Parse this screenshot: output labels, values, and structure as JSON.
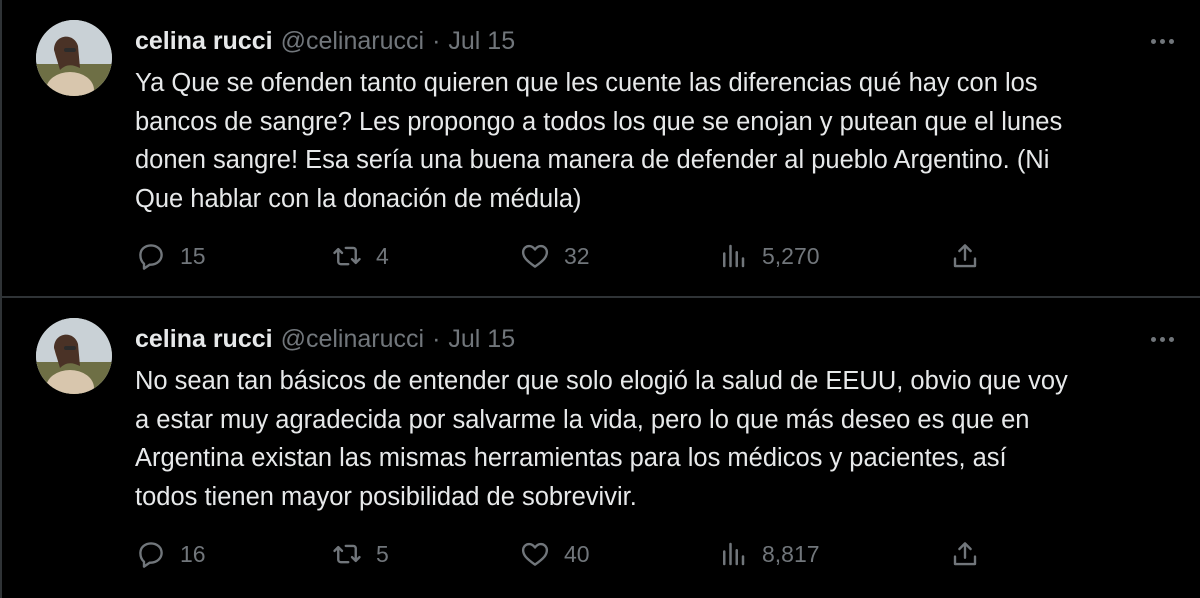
{
  "tweets": [
    {
      "author": {
        "name": "celina rucci",
        "handle": "@celinarucci"
      },
      "separator": "·",
      "date": "Jul 15",
      "text_lines": [
        "Ya Que se ofenden tanto quieren que les cuente las diferencias qué hay con los",
        "bancos de sangre? Les propongo a todos los que se enojan y putean que el lunes",
        "donen sangre! Esa sería una buena manera de defender al pueblo Argentino. (Ni",
        "Que hablar con la donación de médula)"
      ],
      "stats": {
        "replies": "15",
        "retweets": "4",
        "likes": "32",
        "views": "5,270"
      },
      "icons": {
        "more": "more-icon",
        "reply": "reply-icon",
        "retweet": "retweet-icon",
        "like": "heart-icon",
        "views": "views-icon",
        "share": "share-icon"
      }
    },
    {
      "author": {
        "name": "celina rucci",
        "handle": "@celinarucci"
      },
      "separator": "·",
      "date": "Jul 15",
      "text_lines": [
        "No sean tan básicos de entender que solo elogió la salud de EEUU, obvio que voy",
        "a estar muy agradecida por salvarme la vida, pero lo que más deseo es que en",
        "Argentina existan las mismas herramientas para los médicos y pacientes, así",
        "todos tienen mayor posibilidad de sobrevivir."
      ],
      "stats": {
        "replies": "16",
        "retweets": "5",
        "likes": "40",
        "views": "8,817"
      },
      "icons": {
        "more": "more-icon",
        "reply": "reply-icon",
        "retweet": "retweet-icon",
        "like": "heart-icon",
        "views": "views-icon",
        "share": "share-icon"
      }
    }
  ],
  "colors": {
    "background": "#000000",
    "text": "#e7e9ea",
    "secondary": "#71767b",
    "divider": "#2f3336"
  }
}
